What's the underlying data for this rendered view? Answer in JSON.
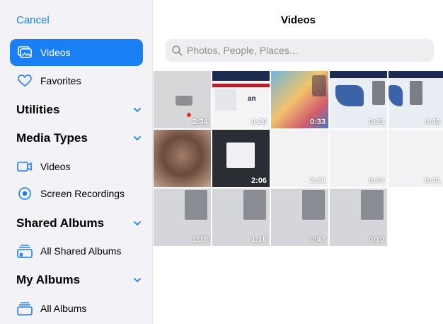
{
  "sidebar": {
    "cancel_label": "Cancel",
    "top_items": [
      {
        "label": "Videos",
        "icon": "photo-stack-icon",
        "active": true
      },
      {
        "label": "Favorites",
        "icon": "heart-icon",
        "active": false
      }
    ],
    "sections": [
      {
        "title": "Utilities",
        "icon": "chevron-down-icon"
      },
      {
        "title": "Media Types",
        "icon": "chevron-down-icon"
      },
      {
        "title": "Shared Albums",
        "icon": "chevron-down-icon"
      },
      {
        "title": "My Albums",
        "icon": "chevron-down-icon"
      }
    ],
    "media_items": [
      {
        "label": "Videos",
        "icon": "video-camera-icon"
      },
      {
        "label": "Screen Recordings",
        "icon": "record-circle-icon"
      }
    ],
    "shared_items": [
      {
        "label": "All Shared Albums",
        "icon": "shared-album-icon"
      }
    ],
    "album_items": [
      {
        "label": "All Albums",
        "icon": "album-stack-icon"
      }
    ]
  },
  "main": {
    "title": "Videos",
    "search_placeholder": "Photos, People, Places...",
    "videos": [
      {
        "duration": "2:34"
      },
      {
        "duration": "0:20"
      },
      {
        "duration": "0:33"
      },
      {
        "duration": "0:35"
      },
      {
        "duration": "0:49"
      },
      {
        "duration": ""
      },
      {
        "duration": "2:06"
      },
      {
        "duration": "2:36"
      },
      {
        "duration": "0:34"
      },
      {
        "duration": "0:44"
      },
      {
        "duration": "1:18"
      },
      {
        "duration": "1:16"
      },
      {
        "duration": "0:47"
      },
      {
        "duration": "0:10"
      }
    ]
  },
  "colors": {
    "accent": "#1a7ef5",
    "sidebar_bg": "#f2f2f7",
    "search_bg": "#eeeef0"
  }
}
